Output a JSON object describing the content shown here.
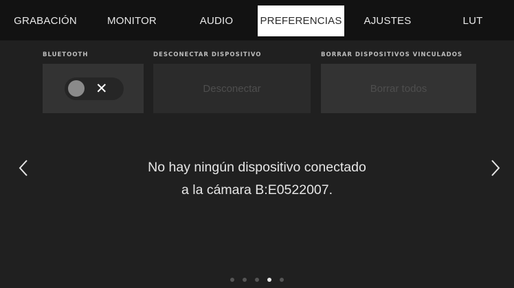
{
  "tabs": [
    {
      "label": "GRABACIÓN",
      "active": false
    },
    {
      "label": "MONITOR",
      "active": false
    },
    {
      "label": "AUDIO",
      "active": false
    },
    {
      "label": "PREFERENCIAS",
      "active": true
    },
    {
      "label": "AJUSTES",
      "active": false
    },
    {
      "label": "LUT",
      "active": false
    }
  ],
  "bluetooth": {
    "label": "BLUETOOTH",
    "toggle_state": "off",
    "toggle_symbol": "✕"
  },
  "disconnect": {
    "label": "DESCONECTAR DISPOSITIVO",
    "button_label": "Desconectar",
    "enabled": false
  },
  "clear_paired": {
    "label": "BORRAR DISPOSITIVOS VINCULADOS",
    "button_label": "Borrar todos",
    "enabled": false
  },
  "message": {
    "line1": "No hay ningún dispositivo conectado",
    "line2": "a la cámara B:E0522007."
  },
  "navigation": {
    "prev_icon": "chevron-left-icon",
    "next_icon": "chevron-right-icon"
  },
  "pagination": {
    "total_pages": 5,
    "current_page": 4
  },
  "colors": {
    "background": "#202020",
    "tabbar": "#121212",
    "active_tab": "#ffffff",
    "panel": "#333333"
  }
}
